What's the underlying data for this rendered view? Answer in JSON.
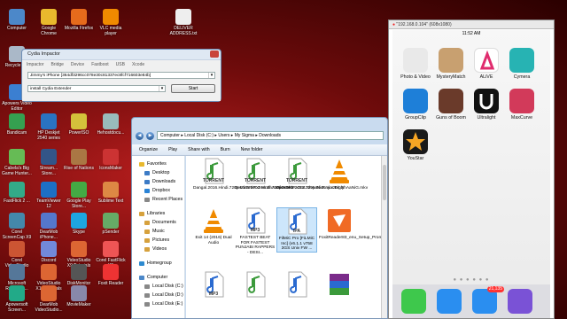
{
  "desktop": {
    "icons": [
      {
        "label": "Computer",
        "color": "#4c88c9"
      },
      {
        "label": "Google Chrome",
        "color": "#e9b92d"
      },
      {
        "label": "Mozilla Firefox",
        "color": "#e66b1c"
      },
      {
        "label": "VLC media player",
        "color": "#f08a00"
      },
      {
        "label": "DELIVER ADDRESS.txt",
        "color": "#eeeeee"
      },
      {
        "label": "Recycle B...",
        "color": "#aab8c8"
      },
      {
        "label": "Apowers Video Editor",
        "color": "#3b7fd1"
      },
      {
        "label": "Bandicam",
        "color": "#35a050"
      },
      {
        "label": "HP Deskjet 2540 series",
        "color": "#2a73c2"
      },
      {
        "label": "PowerISO",
        "color": "#d4c23b"
      },
      {
        "label": "Hehostdocu...",
        "color": "#9bb"
      },
      {
        "label": "Cabela's Big Game Hunter...",
        "color": "#6b5"
      },
      {
        "label": "Stream... Store...",
        "color": "#358"
      },
      {
        "label": "Rise of Nations",
        "color": "#a74"
      },
      {
        "label": "IconsMaker",
        "color": "#c33"
      },
      {
        "label": "FastFlick 2 ...",
        "color": "#3a8"
      },
      {
        "label": "TeamViewer 12",
        "color": "#1d6fc5"
      },
      {
        "label": "Google Play Store...",
        "color": "#4a4"
      },
      {
        "label": "Sublime Text",
        "color": "#d84"
      },
      {
        "label": "Corel ScreenCap X9",
        "color": "#48a"
      },
      {
        "label": "DearMob iPhone...",
        "color": "#57c"
      },
      {
        "label": "Skype",
        "color": "#1ea5e0"
      },
      {
        "label": "pSender",
        "color": "#6a6"
      },
      {
        "label": "Corel VideoStudio X9",
        "color": "#c53"
      },
      {
        "label": "Discord",
        "color": "#7289da"
      },
      {
        "label": "VideoStudio X9 Tutorials",
        "color": "#d63"
      },
      {
        "label": "Corel FastFlick X9",
        "color": "#e55"
      },
      {
        "label": "Microsoft Resource...",
        "color": "#579"
      },
      {
        "label": "VideoStudio X10 Tutorials",
        "color": "#d63"
      },
      {
        "label": "DiskMonitor",
        "color": "#555"
      },
      {
        "label": "Foxit Reader",
        "color": "#e33"
      },
      {
        "label": "Apowersoft Screen...",
        "color": "#2a8"
      },
      {
        "label": "DearMob VideoStudio...",
        "color": "#d63"
      },
      {
        "label": "MovieMaker",
        "color": "#88a"
      }
    ]
  },
  "cydia": {
    "title": "Cydia Impactor",
    "menu": [
      "Impactor",
      "Bridge",
      "Device",
      "Fastboot",
      "USB",
      "Xcode"
    ],
    "device_value": "Jimmy's iPhone [364df3296cc078e30c81337ec8fcf716603e84b]",
    "action_value": "install Cydia Extender",
    "start_label": "Start"
  },
  "explorer": {
    "path": [
      "Computer",
      "Local Disk (C:)",
      "Users",
      "My Sigma",
      "Downloads"
    ],
    "toolbar": [
      "Organize",
      "Play",
      "Share with",
      "Burn",
      "New folder"
    ],
    "nav": [
      {
        "label": "Favorites",
        "type": "head",
        "color": "#e8b82d"
      },
      {
        "label": "Desktop",
        "type": "sub",
        "color": "#3c7bc6"
      },
      {
        "label": "Downloads",
        "type": "sub",
        "color": "#3c7bc6"
      },
      {
        "label": "Dropbox",
        "type": "sub",
        "color": "#2a83d6"
      },
      {
        "label": "Recent Places",
        "type": "sub",
        "color": "#888"
      },
      {
        "label": "Libraries",
        "type": "head-gap",
        "color": "#d6a13d"
      },
      {
        "label": "Documents",
        "type": "sub",
        "color": "#d6a13d"
      },
      {
        "label": "Music",
        "type": "sub",
        "color": "#d6a13d"
      },
      {
        "label": "Pictures",
        "type": "sub",
        "color": "#d6a13d"
      },
      {
        "label": "Videos",
        "type": "sub",
        "color": "#d6a13d"
      },
      {
        "label": "Homegroup",
        "type": "head-gap",
        "color": "#2d8ad0"
      },
      {
        "label": "Computer",
        "type": "head-gap",
        "color": "#4c88c9"
      },
      {
        "label": "Local Disk (C:)",
        "type": "sub",
        "color": "#888"
      },
      {
        "label": "Local Disk (D:)",
        "type": "sub",
        "color": "#888"
      },
      {
        "label": "Local Disk (E:)",
        "type": "sub",
        "color": "#888"
      }
    ],
    "files": [
      {
        "name": "Dangal.2016.Hindi.720p.DVDRiP.x264.ShAaNiG.mkv",
        "kind": "torrent",
        "tag": "TORRENT"
      },
      {
        "name": "Devdas.2002.Hindi.720p.HDRiP.x264.ShAaNiG.mkv",
        "kind": "torrent",
        "tag": "TORRENT"
      },
      {
        "name": "Dhoom.3.2013.720p.BluRay.x264.ShAaNiG.mkv",
        "kind": "torrent",
        "tag": "TORRENT"
      },
      {
        "name": "Digly",
        "kind": "vlc",
        "tag": ""
      },
      {
        "name": "Exit 14 (2016) Dual Audio",
        "kind": "vlc",
        "tag": ""
      },
      {
        "name": "FASTEST BEAT FOR FASTEST PUNJABI RAPPERS - DESI...",
        "kind": "mp3",
        "tag": "MP3"
      },
      {
        "name": "FilMiC Pro [FiLMiC Inc] (v6.1.1 v758 3GS Univ FW ...",
        "kind": "ipa",
        "tag": "IPA"
      },
      {
        "name": "FoxitReader83_enu_Setup_Prom",
        "kind": "foxit",
        "tag": ""
      },
      {
        "name": "",
        "kind": "mp3",
        "tag": "MP3"
      },
      {
        "name": "",
        "kind": "torrent",
        "tag": ""
      },
      {
        "name": "",
        "kind": "mp3",
        "tag": ""
      },
      {
        "name": "",
        "kind": "rar",
        "tag": ""
      }
    ]
  },
  "phone": {
    "window_title": "\"192.168.0.104\" (608x1080)",
    "time": "11:52 AM",
    "apps": [
      {
        "label": "Photo & Video",
        "color": "#e9e9e9"
      },
      {
        "label": "MysteryMatch",
        "color": "#c8a070"
      },
      {
        "label": "ALiVE",
        "color": "#ffffff"
      },
      {
        "label": "Cymera",
        "color": "#27b3b3"
      },
      {
        "label": "GroupClip",
        "color": "#1e7fd8"
      },
      {
        "label": "Guns of Boom",
        "color": "#6a3a2a"
      },
      {
        "label": "Ultralight",
        "color": "#111111"
      },
      {
        "label": "MaxCurve",
        "color": "#d23a5a"
      },
      {
        "label": "YouStar",
        "color": "#1a1a1a"
      }
    ],
    "dock": [
      {
        "name": "phone",
        "color": "#3ec84c"
      },
      {
        "name": "safari",
        "color": "#2a8ef0"
      },
      {
        "name": "mail",
        "color": "#2a8ef0",
        "badge": "21,135"
      },
      {
        "name": "cash",
        "color": "#7a52d6"
      }
    ],
    "page_dots": "● ● ● ● ● ●"
  }
}
